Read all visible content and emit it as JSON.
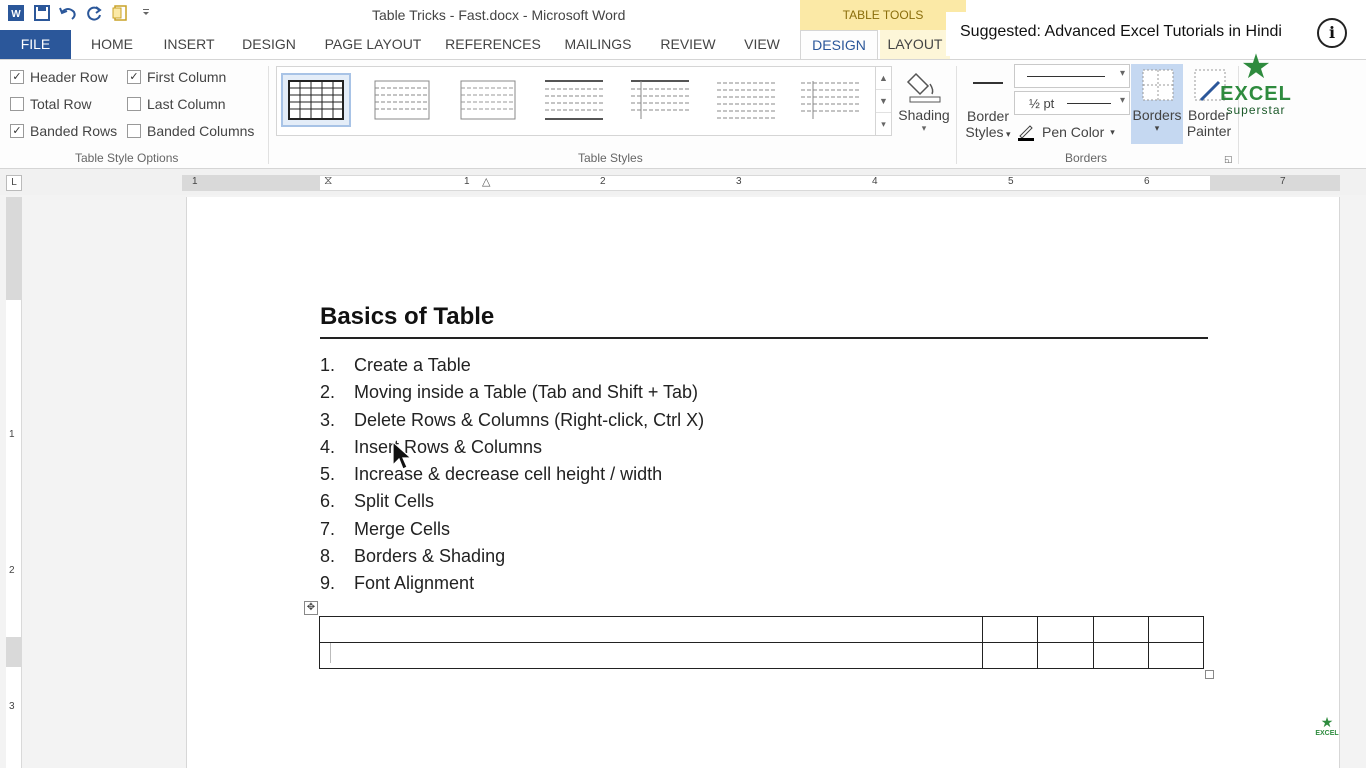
{
  "window": {
    "title": "Table Tricks - Fast.docx - Microsoft Word"
  },
  "qat": {
    "icons": [
      "word-logo-icon",
      "save-icon",
      "undo-icon",
      "redo-icon",
      "new-doc-icon",
      "customize-qat-icon"
    ]
  },
  "contextual": {
    "label": "TABLE TOOLS"
  },
  "tabs": [
    {
      "label": "FILE"
    },
    {
      "label": "HOME"
    },
    {
      "label": "INSERT"
    },
    {
      "label": "DESIGN"
    },
    {
      "label": "PAGE LAYOUT"
    },
    {
      "label": "REFERENCES"
    },
    {
      "label": "MAILINGS"
    },
    {
      "label": "REVIEW"
    },
    {
      "label": "VIEW"
    },
    {
      "label": "DESIGN"
    },
    {
      "label": "LAYOUT"
    }
  ],
  "ribbon": {
    "style_options": {
      "group_label": "Table Style Options",
      "items": [
        {
          "label": "Header Row",
          "checked": true
        },
        {
          "label": "First Column",
          "checked": true
        },
        {
          "label": "Total Row",
          "checked": false
        },
        {
          "label": "Last Column",
          "checked": false
        },
        {
          "label": "Banded Rows",
          "checked": true
        },
        {
          "label": "Banded Columns",
          "checked": false
        }
      ]
    },
    "table_styles": {
      "group_label": "Table Styles"
    },
    "shading": {
      "label": "Shading"
    },
    "borders_group": {
      "group_label": "Borders",
      "border_styles_line1": "Border",
      "border_styles_line2": "Styles",
      "pen_weight": "½ pt",
      "pen_color": "Pen Color",
      "borders": "Borders",
      "border_painter_line1": "Border",
      "border_painter_line2": "Painter"
    }
  },
  "ruler": {
    "numbers": [
      "1",
      "1",
      "2",
      "3",
      "4",
      "5",
      "6",
      "7"
    ],
    "vertical_numbers": [
      "1",
      "2",
      "3"
    ],
    "tab_selector": "L"
  },
  "document": {
    "heading": "Basics of Table",
    "list": [
      {
        "num": "1.",
        "text": "Create a Table"
      },
      {
        "num": "2.",
        "text": "Moving inside a Table (Tab and Shift + Tab)"
      },
      {
        "num": "3.",
        "text": "Delete Rows & Columns (Right-click, Ctrl X)"
      },
      {
        "num": "4.",
        "text": "Insert Rows & Columns"
      },
      {
        "num": "5.",
        "text": "Increase & decrease cell height / width"
      },
      {
        "num": "6.",
        "text": "Split Cells"
      },
      {
        "num": "7.",
        "text": "Merge Cells"
      },
      {
        "num": "8.",
        "text": "Borders & Shading"
      },
      {
        "num": "9.",
        "text": "Font Alignment"
      }
    ],
    "table": {
      "rows": 2,
      "cols": 5
    }
  },
  "overlay": {
    "suggested": "Suggested: Advanced Excel Tutorials in Hindi",
    "info": "i",
    "logo_line1": "EXCEL",
    "logo_line2": "superstar",
    "watermark": "EXCEL"
  },
  "colors": {
    "accent": "#2b579a",
    "contextual": "#fbe9a6",
    "brand_green": "#2e8b3e"
  }
}
